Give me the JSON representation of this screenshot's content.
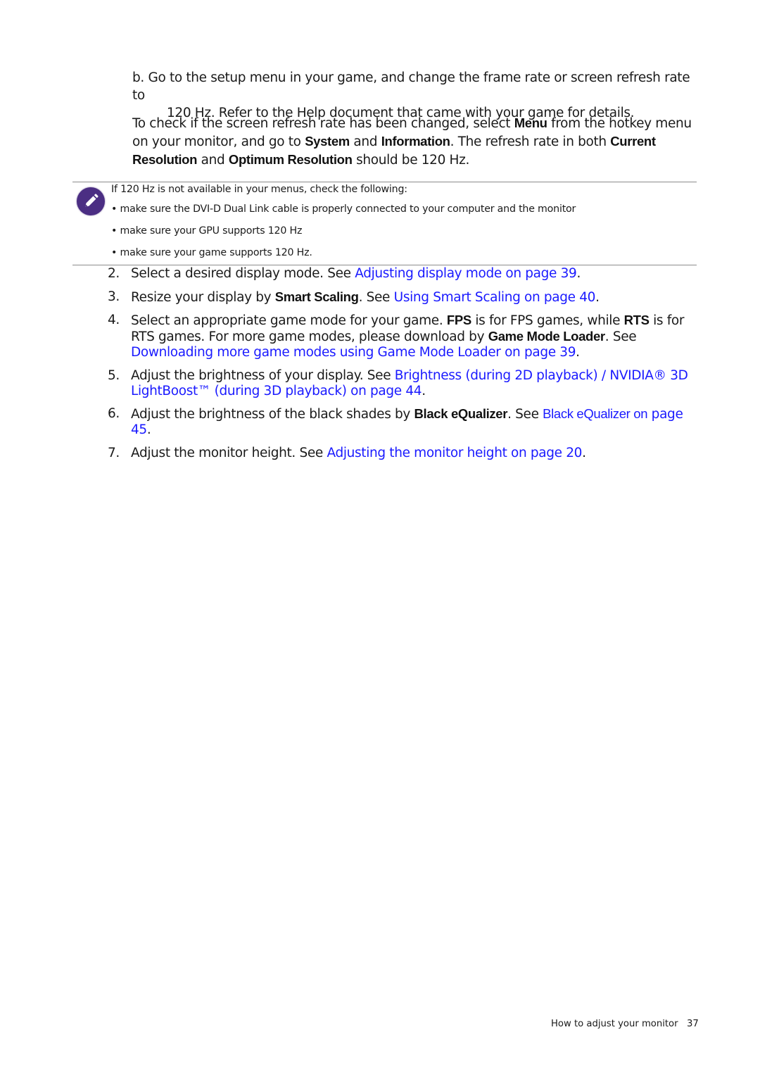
{
  "step_b": {
    "label": "b.",
    "line1": "Go to the setup menu in your game, and change the frame rate or screen refresh rate to",
    "line2": "120 Hz. Refer to the Help document that came with your game for details."
  },
  "check_para": {
    "t1": "To check if the screen refresh rate has been changed, select ",
    "menu": "Menu",
    "t2": " from the hotkey menu on your monitor, and go to ",
    "system": "System",
    "t3": " and ",
    "information": "Information",
    "t4": ". The refresh rate in both ",
    "current_resolution": "Current Resolution",
    "t5": " and ",
    "optimum_resolution": "Optimum Resolution",
    "t6": " should be 120 Hz."
  },
  "note": {
    "icon": "pencil-icon",
    "intro": "If 120 Hz is not available in your menus, check the following:",
    "bullets": [
      "• make sure the DVI-D Dual Link cable is properly connected to your computer and the monitor",
      "• make sure your GPU supports 120 Hz",
      "• make sure your game supports 120 Hz."
    ]
  },
  "steps": [
    {
      "num": "2.",
      "t1": "Select a desired display mode. See ",
      "link": "Adjusting display mode on page 39",
      "t2": "."
    },
    {
      "num": "3.",
      "t1": "Resize your display by ",
      "term": "Smart Scaling",
      "t2": ". See ",
      "link": "Using Smart Scaling on page 40",
      "t3": "."
    },
    {
      "num": "4.",
      "t1": "Select an appropriate game mode for your game. ",
      "term1": "FPS",
      "t2": " is for FPS games, while ",
      "term2": "RTS",
      "t3": " is for RTS games. For more game modes, please download by ",
      "term3": "Game Mode Loader",
      "t4": ". See ",
      "link": "Downloading more game modes using Game Mode Loader on page 39",
      "t5": "."
    },
    {
      "num": "5.",
      "t1": "Adjust the brightness of your display. See ",
      "link": "Brightness (during 2D playback) / NVIDIA® 3D LightBoost™ (during 3D playback) on page 44",
      "t2": "."
    },
    {
      "num": "6.",
      "t1": "Adjust the brightness of the black shades by ",
      "term": "Black eQualizer",
      "t2": ". See ",
      "link_a": "Black eQualizer on",
      "link_b": "page 45",
      "t3": "."
    },
    {
      "num": "7.",
      "t1": "Adjust the monitor height. See ",
      "link": "Adjusting the monitor height on page 20",
      "t2": "."
    }
  ],
  "footer": {
    "section_title": "How to adjust your monitor",
    "page_number": "37"
  },
  "colors": {
    "link": "#1a1aff",
    "note_icon_bg": "#4b2e83",
    "rule": "#8c8c8c"
  }
}
